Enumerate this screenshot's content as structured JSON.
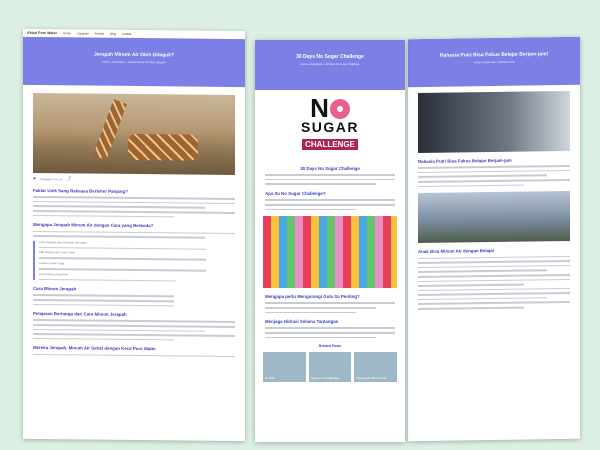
{
  "left": {
    "brand": "Aktari Pure Water",
    "nav": [
      "Home",
      "Layanan",
      "Produk",
      "Blog",
      "Kontak"
    ],
    "hero_title": "Jerapah Minum Air Oleh Ditegok?",
    "hero_crumb": "Home » Kesehatan » Jerapah Minum Air Oleh Ditegok?",
    "author": "Tanggalan Pure H2",
    "h1": "Faktar Unik Sang Raksasa Berleher Panjang?",
    "h2": "Mengapa Jerapah Minum Air dengan Cara yang Berbeda?",
    "items": [
      "Leher Panjang yang Membuat Tantangan",
      "Kaki Panjang dan Posisi Tubuh",
      "Tekanan Darah Tinggi",
      "Posisi Minum yang Aman"
    ],
    "h3": "Cara Minum Jerapah",
    "h4": "Pelajaran Berharga dari Cara Minum Jerapah",
    "h5": "Mereka Jerapah, Minum Air Sehat dengan Kecil Pure Water"
  },
  "middle": {
    "hero_title": "30 Days No Sugar Challenge",
    "hero_crumb": "Home » Kesehatan » 30 Days No Sugar Challenge",
    "logo_line1a": "N",
    "logo_line1b": "",
    "logo_line1c": "",
    "logo_line2": "SUGAR",
    "logo_line3": "CHALLENGE",
    "h1": "30 Days No Sugar Challenge",
    "h2": "Apa Itu No Sugar Challenge?",
    "h3": "Mengapa perlu Mengurangi Gula Sa Penting?",
    "h4": "Menjaga Hidrasi Selama Tantangan",
    "related_title": "Related Posts",
    "related": [
      "Air Putih",
      "Tetapi Air Lebih Menjaga",
      "Penanganan Bantu Untuk"
    ]
  },
  "right": {
    "hero_title": "Rahasia Putri Bisa Fokus Belajar Berjam-jam!",
    "hero_crumb": "Home » Kesehatan » Rahasia Putri",
    "h1": "Rahasia Putri Bisa Fokus Belajar Berjam-jam",
    "h2": "Anak Bisa Minum Air dengan Belajar"
  },
  "colors": {
    "hero": "#7b7fe6",
    "heading": "#3a3fbf",
    "bg": "#dcefe3"
  }
}
